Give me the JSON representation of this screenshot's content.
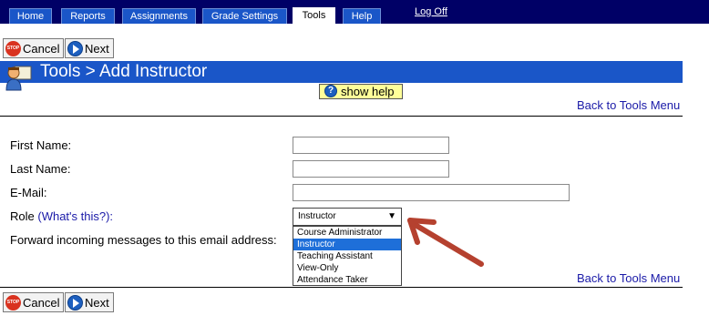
{
  "nav": {
    "tabs": [
      "Home",
      "Reports",
      "Assignments",
      "Grade Settings",
      "Tools",
      "Help"
    ],
    "active_tab": "Tools",
    "logoff": "Log Off"
  },
  "buttons": {
    "cancel": "Cancel",
    "next": "Next",
    "stop_icon_text": "STOP"
  },
  "page": {
    "title": "Tools > Add Instructor",
    "show_help": "show help",
    "back_link": "Back to Tools Menu"
  },
  "form": {
    "first_name_label": "First Name:",
    "last_name_label": "Last Name:",
    "email_label": "E-Mail:",
    "role_label": "Role",
    "role_help_link": "(What's this?):",
    "forward_label": "Forward incoming messages to this email address:",
    "role_selected": "Instructor",
    "role_options": [
      "Course Administrator",
      "Instructor",
      "Teaching Assistant",
      "View-Only",
      "Attendance Taker"
    ]
  },
  "colors": {
    "nav_bg": "#000066",
    "tab_bg": "#1a56c8",
    "title_bar": "#1a56c8",
    "help_bg": "#ffff99",
    "link": "#1a1aa8",
    "arrow": "#b5412f",
    "option_highlight": "#1e6fd9"
  },
  "icons": {
    "stop": "stop-sign-icon",
    "next": "next-arrow-icon",
    "help": "help-icon",
    "title": "instructor-icon"
  }
}
